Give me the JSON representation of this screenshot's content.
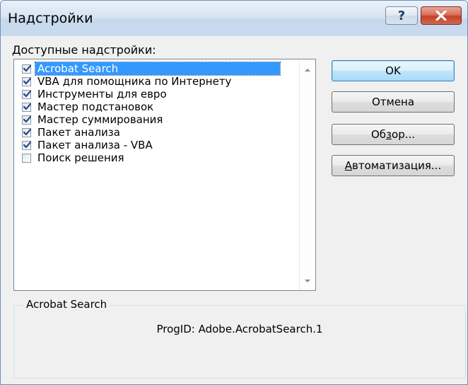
{
  "window": {
    "title": "Надстройки"
  },
  "list": {
    "label": "Доступные надстройки:",
    "items": [
      {
        "label": "Acrobat Search",
        "checked": true,
        "selected": true
      },
      {
        "label": "VBA для помощника по Интернету",
        "checked": true,
        "selected": false
      },
      {
        "label": "Инструменты для евро",
        "checked": true,
        "selected": false
      },
      {
        "label": "Мастер подстановок",
        "checked": true,
        "selected": false
      },
      {
        "label": "Мастер суммирования",
        "checked": true,
        "selected": false
      },
      {
        "label": "Пакет анализа",
        "checked": true,
        "selected": false
      },
      {
        "label": "Пакет анализа - VBA",
        "checked": true,
        "selected": false
      },
      {
        "label": "Поиск решения",
        "checked": false,
        "selected": false
      }
    ]
  },
  "buttons": {
    "ok": "OK",
    "cancel": "Отмена",
    "browse_pre": "Об",
    "browse_mnemonic": "з",
    "browse_post": "ор...",
    "automation_mnemonic": "А",
    "automation_post": "втоматизация..."
  },
  "details": {
    "title": "Acrobat Search",
    "progid": "ProgID: Adobe.AcrobatSearch.1"
  },
  "colors": {
    "selection": "#3399ff",
    "titlebar": "#c9dbee",
    "close": "#c2412a"
  },
  "icons": {
    "help": "question-mark-icon",
    "close": "close-x-icon",
    "check": "checkmark-icon",
    "scroll_up": "scroll-up-arrow-icon",
    "scroll_down": "scroll-down-arrow-icon"
  }
}
